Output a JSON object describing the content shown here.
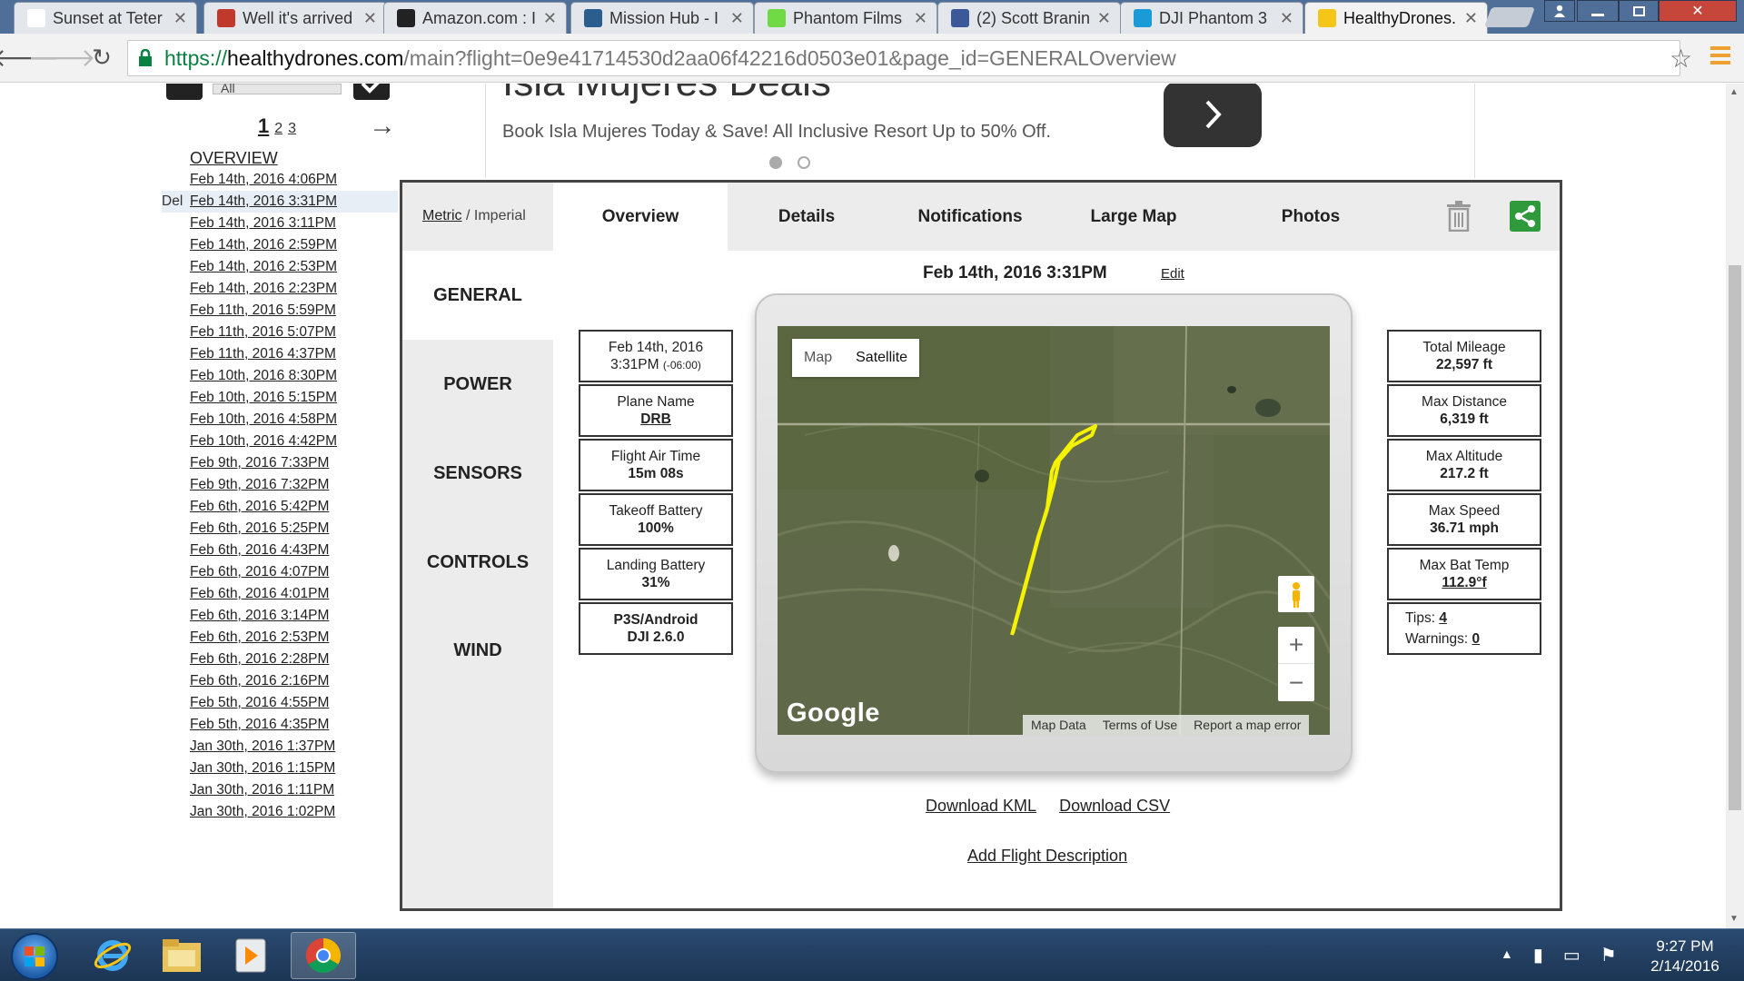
{
  "browser": {
    "tabs": [
      {
        "title": "Sunset at Teter",
        "icon": "flickr-icon",
        "color": "#ffffff",
        "active": false
      },
      {
        "title": "Well it's arrived",
        "icon": "forum-icon",
        "color": "#c0392b",
        "active": false
      },
      {
        "title": "Amazon.com : I",
        "icon": "amazon-icon",
        "color": "#222222",
        "active": false
      },
      {
        "title": "Mission Hub - I",
        "icon": "mission-hub-icon",
        "color": "#2c5d8f",
        "active": false
      },
      {
        "title": "Phantom Films",
        "icon": "upwork-icon",
        "color": "#6fda44",
        "active": false
      },
      {
        "title": "(2) Scott Branin",
        "icon": "facebook-icon",
        "color": "#3b5998",
        "active": false
      },
      {
        "title": "DJI Phantom 3",
        "icon": "dji-icon",
        "color": "#1a9bd7",
        "active": false
      },
      {
        "title": "HealthyDrones.",
        "icon": "healthydrones-icon",
        "color": "#f5c518",
        "active": true
      }
    ],
    "url": {
      "scheme": "https://",
      "host": "healthydrones.com",
      "path": "/main?flight=0e9e41714530d2aa06f42216d0503e01&page_id=GENERALOverview"
    }
  },
  "ad": {
    "title": "Isla Mujeres Deals",
    "text": "Book Isla Mujeres Today & Save! All Inclusive Resort Up to 50% Off."
  },
  "sidebar": {
    "select_value": "All",
    "pages": {
      "current": "1",
      "others": [
        "2",
        "3"
      ]
    },
    "overview_label": "OVERVIEW",
    "del_label": "Del",
    "flights": [
      "Feb 14th, 2016 4:06PM",
      "Feb 14th, 2016 3:31PM",
      "Feb 14th, 2016 3:11PM",
      "Feb 14th, 2016 2:59PM",
      "Feb 14th, 2016 2:53PM",
      "Feb 14th, 2016 2:23PM",
      "Feb 11th, 2016 5:59PM",
      "Feb 11th, 2016 5:07PM",
      "Feb 11th, 2016 4:37PM",
      "Feb 10th, 2016 8:30PM",
      "Feb 10th, 2016 5:15PM",
      "Feb 10th, 2016 4:58PM",
      "Feb 10th, 2016 4:42PM",
      "Feb 9th, 2016 7:33PM",
      "Feb 9th, 2016 7:32PM",
      "Feb 6th, 2016 5:42PM",
      "Feb 6th, 2016 5:25PM",
      "Feb 6th, 2016 4:43PM",
      "Feb 6th, 2016 4:07PM",
      "Feb 6th, 2016 4:01PM",
      "Feb 6th, 2016 3:14PM",
      "Feb 6th, 2016 2:53PM",
      "Feb 6th, 2016 2:28PM",
      "Feb 6th, 2016 2:16PM",
      "Feb 5th, 2016 4:55PM",
      "Feb 5th, 2016 4:35PM",
      "Jan 30th, 2016 1:37PM",
      "Jan 30th, 2016 1:15PM",
      "Jan 30th, 2016 1:11PM",
      "Jan 30th, 2016 1:02PM"
    ],
    "selected_index": 1
  },
  "panel": {
    "units": {
      "metric": "Metric",
      "sep": " / ",
      "imperial": "Imperial"
    },
    "tabs": [
      "Overview",
      "Details",
      "Notifications",
      "Large Map",
      "Photos"
    ],
    "active_tab": "Overview",
    "sections": [
      "GENERAL",
      "POWER",
      "SENSORS",
      "CONTROLS",
      "WIND"
    ],
    "active_section": "GENERAL",
    "flight_title": "Feb 14th, 2016 3:31PM",
    "edit_label": "Edit",
    "left_stats": {
      "date": {
        "line1": "Feb 14th, 2016",
        "line2": "3:31PM",
        "tz": "(-06:00)"
      },
      "plane": {
        "label": "Plane Name",
        "value": "DRB"
      },
      "airtime": {
        "label": "Flight Air Time",
        "value": "15m 08s"
      },
      "takeoff": {
        "label": "Takeoff Battery",
        "value": "100%"
      },
      "landing": {
        "label": "Landing Battery",
        "value": "31%"
      },
      "device": {
        "line1": "P3S/Android",
        "line2": "DJI 2.6.0"
      }
    },
    "right_stats": {
      "mileage": {
        "label": "Total Mileage",
        "value": "22,597 ft"
      },
      "distance": {
        "label": "Max Distance",
        "value": "6,319 ft"
      },
      "altitude": {
        "label": "Max Altitude",
        "value": "217.2 ft"
      },
      "speed": {
        "label": "Max Speed",
        "value": "36.71 mph"
      },
      "battemp": {
        "label": "Max Bat Temp",
        "value": "112.9°f"
      },
      "tips": {
        "tips_label": "Tips:",
        "tips_value": "4",
        "warn_label": "Warnings:",
        "warn_value": "0"
      }
    },
    "map": {
      "types": [
        "Map",
        "Satellite"
      ],
      "selected_type": "Satellite",
      "logo": "Google",
      "attribution": [
        "Map Data",
        "Terms of Use",
        "Report a map error"
      ],
      "path_color": "#f5f200"
    },
    "downloads": [
      "Download KML",
      "Download CSV"
    ],
    "add_description": "Add Flight Description"
  },
  "taskbar": {
    "time": "9:27 PM",
    "date": "2/14/2016"
  }
}
